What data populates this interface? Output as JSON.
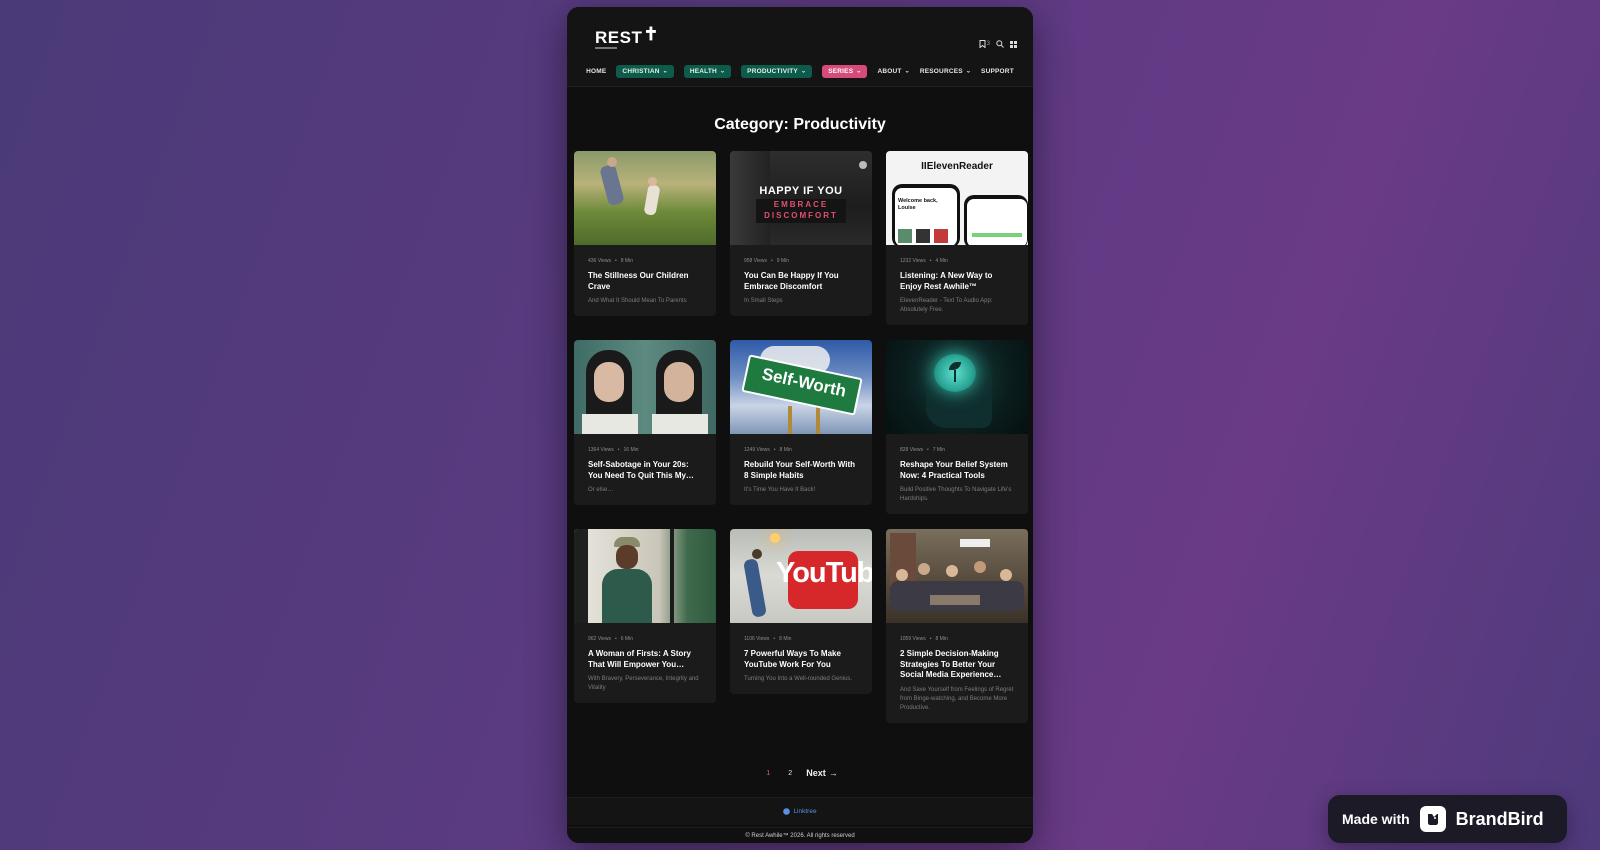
{
  "site": {
    "logo_text": "REST",
    "logo_mark": "✝",
    "bookmark_count": "3"
  },
  "nav": [
    {
      "label": "HOME",
      "style": "plain",
      "has_dropdown": false
    },
    {
      "label": "CHRISTIAN",
      "style": "teal",
      "has_dropdown": true
    },
    {
      "label": "HEALTH",
      "style": "teal",
      "has_dropdown": true
    },
    {
      "label": "PRODUCTIVITY",
      "style": "teal",
      "has_dropdown": true
    },
    {
      "label": "SERIES",
      "style": "pink",
      "has_dropdown": true
    },
    {
      "label": "ABOUT",
      "style": "plain",
      "has_dropdown": true
    },
    {
      "label": "RESOURCES",
      "style": "plain",
      "has_dropdown": true
    },
    {
      "label": "SUPPORT",
      "style": "plain",
      "has_dropdown": false
    }
  ],
  "category_title": "Category: Productivity",
  "posts": [
    {
      "views": "436 Views",
      "read": "8 Min",
      "title": "The Stillness Our Children Crave",
      "subtitle": "And What It Should Mean To Parents"
    },
    {
      "views": "958 Views",
      "read": "9 Min",
      "title": "You Can Be Happy If You Embrace Discomfort",
      "subtitle": "In Small Steps",
      "thumb_text": [
        "HAPPY IF YOU",
        "EMBRACE",
        "DISCOMFORT"
      ]
    },
    {
      "views": "1232 Views",
      "read": "4 Min",
      "title": "Listening: A New Way to Enjoy Rest Awhile™",
      "subtitle": "ElevenReader - Text To Audio App: Absolutely Free.",
      "thumb_text": [
        "IIElevenReader",
        "Welcome back, Louise"
      ]
    },
    {
      "views": "1364 Views",
      "read": "16 Min",
      "title": "Self-Sabotage in Your 20s: You Need To Quit This My…",
      "subtitle": "Or else…"
    },
    {
      "views": "1249 Views",
      "read": "8 Min",
      "title": "Rebuild Your Self-Worth With 8 Simple Habits",
      "subtitle": "It's Time You Have It Back!",
      "thumb_text": [
        "Self-Worth"
      ]
    },
    {
      "views": "828 Views",
      "read": "7 Min",
      "title": "Reshape Your Belief System Now: 4 Practical Tools",
      "subtitle": "Build Positive Thoughts To Navigate Life's Hardships."
    },
    {
      "views": "962 Views",
      "read": "6 Min",
      "title": "A Woman of Firsts: A Story That Will Empower You…",
      "subtitle": "With Bravery, Perseverance, Integrity and Vitality"
    },
    {
      "views": "1106 Views",
      "read": "8 Min",
      "title": "7 Powerful Ways To Make YouTube Work For You",
      "subtitle": "Turning You Into a Well-rounded Genius.",
      "thumb_text": [
        "YouTub"
      ]
    },
    {
      "views": "1059 Views",
      "read": "8 Min",
      "title": "2 Simple Decision-Making Strategies To Better Your Social Media Experience…",
      "subtitle": "And Save Yourself from Feelings of Regret from Binge-watching, and Become More Productive."
    }
  ],
  "pagination": {
    "pages": [
      "1",
      "2"
    ],
    "current": "1",
    "next_label": "Next"
  },
  "footer": {
    "link_label": "Linktree",
    "copyright": "© Rest Awhile™ 2026. All rights reserved"
  },
  "badge": {
    "made_with": "Made with",
    "brand": "BrandBird"
  },
  "colors": {
    "teal_pill": "#0e5b4c",
    "pink_pill": "#d64b7a",
    "page_bg": "#0f0f10",
    "card_bg": "#1b1b1c",
    "link_blue": "#5a8fe8"
  }
}
